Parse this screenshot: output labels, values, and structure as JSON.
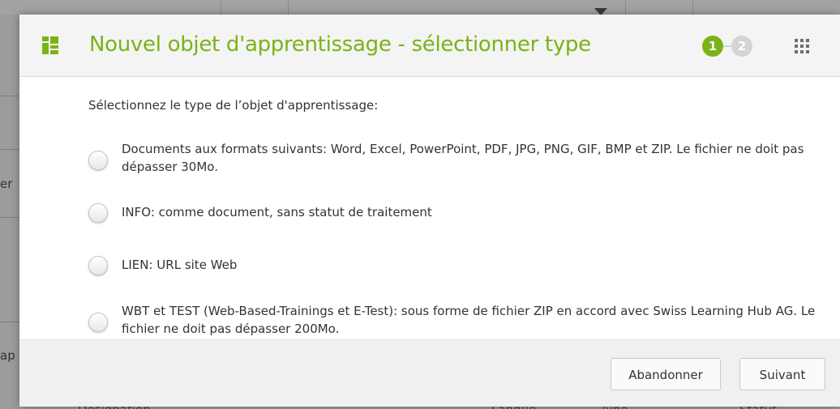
{
  "background": {
    "left_text_1": "er",
    "left_text_2": "ap",
    "bottom_text_1": "Désignation",
    "bottom_text_2": "Langue",
    "bottom_text_3": "Type",
    "bottom_text_4": "Statut"
  },
  "modal": {
    "header_icon": "learning-object-icon",
    "title": "Nouvel objet d'apprentissage - sélectionner type",
    "steps": [
      {
        "label": "1",
        "state": "active"
      },
      {
        "label": "2",
        "state": "inactive"
      }
    ],
    "menu_icon": "grid-menu-icon",
    "colors": {
      "accent": "#7ab317",
      "step_inactive": "#d4d4d4",
      "header_bg": "#f4f4f4",
      "footer_bg": "#f0f0f0"
    }
  },
  "body": {
    "prompt": "Sélectionnez le type de l’objet d'apprentissage:",
    "options": [
      {
        "label": "Documents aux formats suivants: Word, Excel, PowerPoint, PDF, JPG, PNG, GIF, BMP et ZIP. Le fichier ne doit pas dépasser 30Mo.",
        "selected": false
      },
      {
        "label": "INFO: comme document, sans statut de traitement",
        "selected": false
      },
      {
        "label": "LIEN: URL site Web",
        "selected": false
      },
      {
        "label": "WBT et TEST (Web-Based-Trainings et E-Test): sous forme de fichier ZIP en accord avec Swiss Learning Hub AG. Le fichier ne doit pas dépasser 200Mo.",
        "selected": false
      }
    ]
  },
  "footer": {
    "cancel_label": "Abandonner",
    "next_label": "Suivant"
  }
}
